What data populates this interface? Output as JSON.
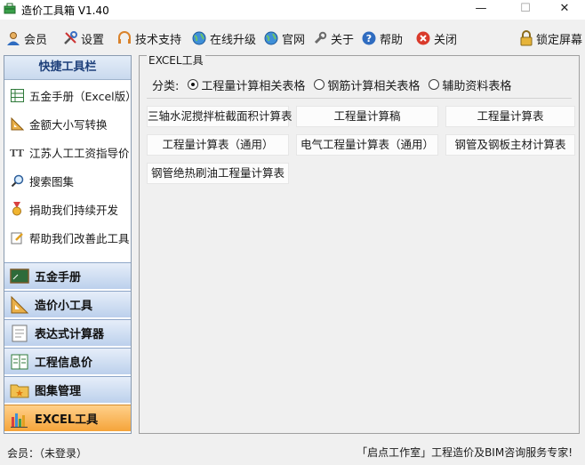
{
  "window": {
    "title": "造价工具箱 V1.40",
    "minimize": "—",
    "maximize": "☐",
    "close": "✕"
  },
  "toolbar": {
    "member": "会员",
    "settings": "设置",
    "support": "技术支持",
    "upgrade": "在线升级",
    "website": "官网",
    "about": "关于",
    "help": "帮助",
    "close": "关闭",
    "lock": "锁定屏幕"
  },
  "quick_tools": {
    "title": "快捷工具栏",
    "items": [
      "五金手册（Excel版）",
      "金额大小写转换",
      "江苏人工工资指导价",
      "搜索图集",
      "捐助我们持续开发",
      "帮助我们改善此工具"
    ]
  },
  "nav": {
    "items": [
      "五金手册",
      "造价小工具",
      "表达式计算器",
      "工程信息价",
      "图集管理",
      "EXCEL工具"
    ],
    "active_index": 5
  },
  "excel_tools": {
    "group_title": "EXCEL工具",
    "category_label": "分类:",
    "categories": [
      "工程量计算相关表格",
      "钢筋计算相关表格",
      "辅助资料表格"
    ],
    "selected_category": 0,
    "buttons": [
      "三轴水泥搅拌桩截面积计算表",
      "工程量计算稿",
      "工程量计算表",
      "工程量计算表（通用）",
      "电气工程量计算表（通用）",
      "钢管及钢板主材计算表",
      "钢管绝热刷油工程量计算表"
    ]
  },
  "status": {
    "member_label": "会员：",
    "member_value": "（未登录）",
    "slogan": "「启点工作室」工程造价及BIM咨询服务专家!"
  }
}
